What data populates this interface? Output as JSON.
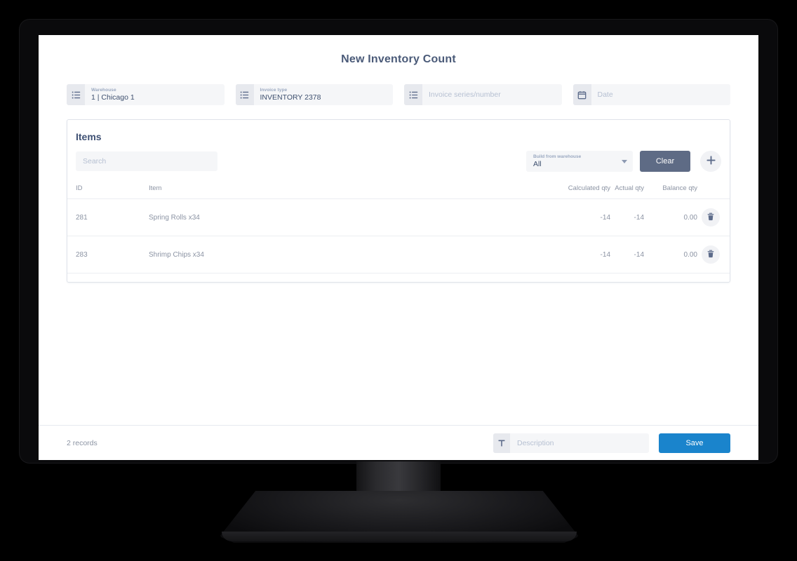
{
  "page": {
    "title": "New Inventory Count"
  },
  "header_fields": [
    {
      "icon": "list-icon",
      "label": "Warehouse",
      "value": "1 | Chicago 1",
      "placeholder": ""
    },
    {
      "icon": "list-icon",
      "label": "Invoice type",
      "value": "INVENTORY 2378",
      "placeholder": ""
    },
    {
      "icon": "list-icon",
      "label": "",
      "value": "",
      "placeholder": "Invoice series/number"
    },
    {
      "icon": "calendar-icon",
      "label": "",
      "value": "",
      "placeholder": "Date"
    }
  ],
  "items": {
    "title": "Items",
    "search_placeholder": "Search",
    "search_value": "",
    "build_select": {
      "label": "Build from warehouse",
      "value": "All"
    },
    "clear_label": "Clear",
    "add_icon": "plus-icon",
    "columns": {
      "id": "ID",
      "item": "Item",
      "calculated_qty": "Calculated qty",
      "actual_qty": "Actual qty",
      "balance_qty": "Balance qty"
    },
    "rows": [
      {
        "id": "281",
        "item": "Spring Rolls x34",
        "calculated_qty": "-14",
        "actual_qty": "-14",
        "balance_qty": "0.00",
        "delete_icon": "trash-icon"
      },
      {
        "id": "283",
        "item": "Shrimp Chips x34",
        "calculated_qty": "-14",
        "actual_qty": "-14",
        "balance_qty": "0.00",
        "delete_icon": "trash-icon"
      }
    ]
  },
  "footer": {
    "records": "2 records",
    "description_placeholder": "Description",
    "description_value": "",
    "description_icon": "text-icon",
    "save_label": "Save"
  },
  "colors": {
    "accent_blue": "#1a84cc",
    "slate": "#5e6b85",
    "title": "#4a5a78",
    "muted": "#8b93a3",
    "placeholder": "#b6c0d2",
    "field_bg": "#f5f6f8",
    "screen_edge": "#1477c8"
  }
}
